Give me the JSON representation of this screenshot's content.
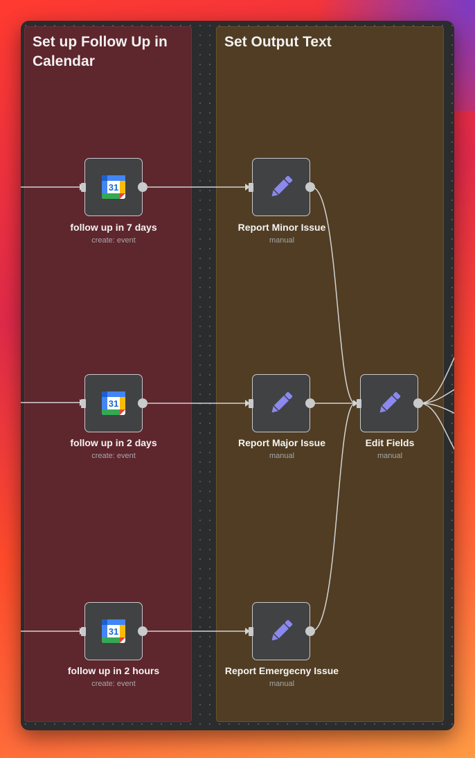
{
  "groups": [
    {
      "title": "Set up Follow Up in Calendar",
      "color": "#5e262d"
    },
    {
      "title": "Set Output Text",
      "color": "#503d23"
    }
  ],
  "nodes": {
    "cal7d": {
      "name": "follow up in 7 days",
      "subtitle": "create: event",
      "icon": "google-calendar-icon"
    },
    "cal2d": {
      "name": "follow up in 2 days",
      "subtitle": "create: event",
      "icon": "google-calendar-icon"
    },
    "cal2h": {
      "name": "follow up in 2 hours",
      "subtitle": "create: event",
      "icon": "google-calendar-icon"
    },
    "minor": {
      "name": "Report Minor Issue",
      "subtitle": "manual",
      "icon": "pencil-icon"
    },
    "major": {
      "name": "Report Major Issue",
      "subtitle": "manual",
      "icon": "pencil-icon"
    },
    "emerg": {
      "name": "Report Emergecny Issue",
      "subtitle": "manual",
      "icon": "pencil-icon"
    },
    "edit": {
      "name": "Edit Fields",
      "subtitle": "manual",
      "icon": "pencil-icon"
    }
  },
  "calendar_icon_text": "31",
  "colors": {
    "accent": "#8b88f0",
    "canvas": "#2b2c2e",
    "node": "#414244"
  }
}
